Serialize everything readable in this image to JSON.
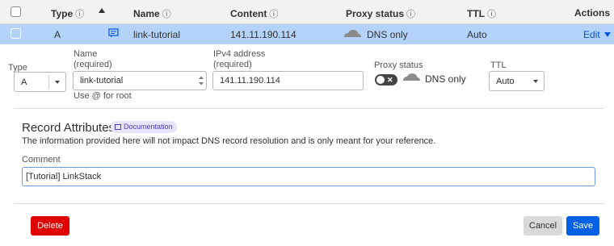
{
  "header": {
    "type": "Type",
    "name": "Name",
    "content": "Content",
    "proxy_status": "Proxy status",
    "ttl": "TTL",
    "actions": "Actions",
    "info_glyph": "ⓘ"
  },
  "record": {
    "type": "A",
    "name": "link-tutorial",
    "content": "141.11.190.114",
    "proxy_status": "DNS only",
    "ttl": "Auto",
    "edit_label": "Edit"
  },
  "form": {
    "type_label": "Type",
    "type_value": "A",
    "name_label": "Name",
    "name_required": "(required)",
    "name_value": "link-tutorial",
    "name_hint": "Use @ for root",
    "ipv4_label": "IPv4 address",
    "ipv4_required": "(required)",
    "ipv4_value": "141.11.190.114",
    "proxy_label": "Proxy status",
    "proxy_value": "DNS only",
    "ttl_label": "TTL",
    "ttl_value": "Auto"
  },
  "attributes": {
    "title": "Record Attributes",
    "doc_badge": "Documentation",
    "description": "The information provided here will not impact DNS record resolution and is only meant for your reference.",
    "comment_label": "Comment",
    "comment_value": "[Tutorial] LinkStack"
  },
  "buttons": {
    "delete": "Delete",
    "cancel": "Cancel",
    "save": "Save"
  },
  "colors": {
    "selected_row": "#b4d3f9",
    "link_blue": "#0055dc",
    "delete_red": "#e00000",
    "save_blue": "#0060e6",
    "cancel_gray": "#d9d9d9"
  }
}
